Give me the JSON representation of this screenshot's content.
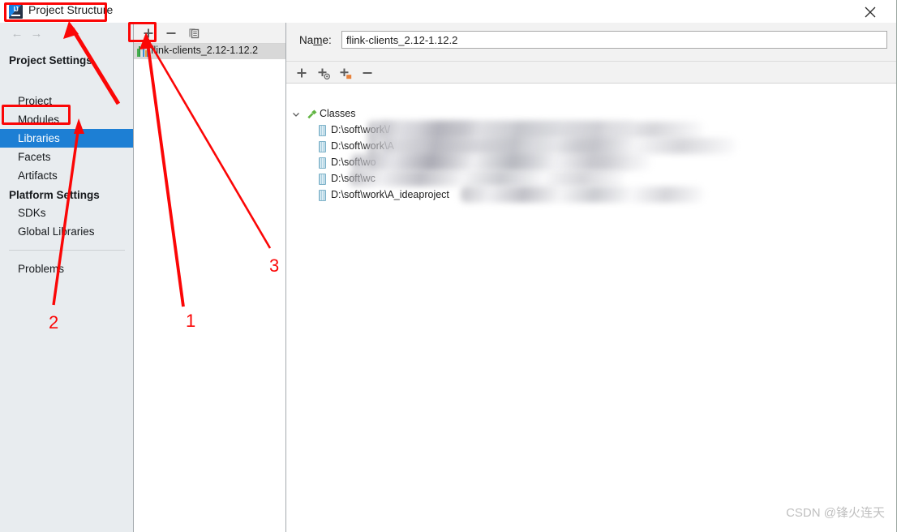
{
  "window": {
    "title": "Project Structure",
    "logo_icon": "intellij-idea-logo-icon",
    "close_icon": "close-icon"
  },
  "nav": {
    "back_icon": "arrow-left-icon",
    "forward_icon": "arrow-right-icon"
  },
  "sidebar": {
    "groups": [
      {
        "label": "Project Settings"
      },
      {
        "label": "Platform Settings"
      }
    ],
    "project_settings_items": [
      {
        "label": "Project",
        "selected": false
      },
      {
        "label": "Modules",
        "selected": false
      },
      {
        "label": "Libraries",
        "selected": true
      },
      {
        "label": "Facets",
        "selected": false
      },
      {
        "label": "Artifacts",
        "selected": false
      }
    ],
    "platform_settings_items": [
      {
        "label": "SDKs",
        "selected": false
      },
      {
        "label": "Global Libraries",
        "selected": false
      }
    ],
    "footer_items": [
      {
        "label": "Problems",
        "selected": false
      }
    ]
  },
  "middle_panel": {
    "toolbar": [
      {
        "name": "add-library-button",
        "icon": "plus-icon"
      },
      {
        "name": "remove-library-button",
        "icon": "minus-icon"
      },
      {
        "name": "copy-library-button",
        "icon": "copy-icon"
      }
    ],
    "libraries": [
      {
        "label": "flink-clients_2.12-1.12.2",
        "icon": "library-icon",
        "selected": true
      }
    ]
  },
  "right_panel": {
    "name_label": "Na",
    "name_label_mnemonic": "m",
    "name_label_rest": "e:",
    "name_value": "flink-clients_2.12-1.12.2",
    "name_placeholder": "",
    "toolbar": [
      {
        "name": "add-entry-button",
        "icon": "plus-icon"
      },
      {
        "name": "attach-classes-button",
        "icon": "plus-circle-icon"
      },
      {
        "name": "attach-jar-directories-button",
        "icon": "plus-folder-icon"
      },
      {
        "name": "remove-entry-button",
        "icon": "minus-icon"
      }
    ],
    "tree": {
      "root": {
        "label": "Classes",
        "icon": "hammer-icon",
        "expand_icon": "chevron-down-icon"
      },
      "entries": [
        {
          "label": "D:\\soft\\work\\/",
          "icon": "jar-icon",
          "redacted": true
        },
        {
          "label": "D:\\soft\\work\\A",
          "icon": "jar-icon",
          "redacted": true
        },
        {
          "label": "D:\\soft\\wo",
          "icon": "jar-icon",
          "redacted": true
        },
        {
          "label": "D:\\soft\\wc",
          "icon": "jar-icon",
          "redacted": true
        },
        {
          "label": "D:\\soft\\work\\A_ideaproject",
          "icon": "jar-icon",
          "redacted": true
        }
      ]
    }
  },
  "annotations": {
    "accent_color": "#fb0606",
    "markers": [
      {
        "number": "1"
      },
      {
        "number": "2"
      },
      {
        "number": "3"
      }
    ],
    "boxes": [
      {
        "name": "title-highlight"
      },
      {
        "name": "libraries-highlight"
      },
      {
        "name": "add-button-highlight"
      }
    ]
  },
  "watermark": {
    "text": "CSDN @锋火连天"
  }
}
